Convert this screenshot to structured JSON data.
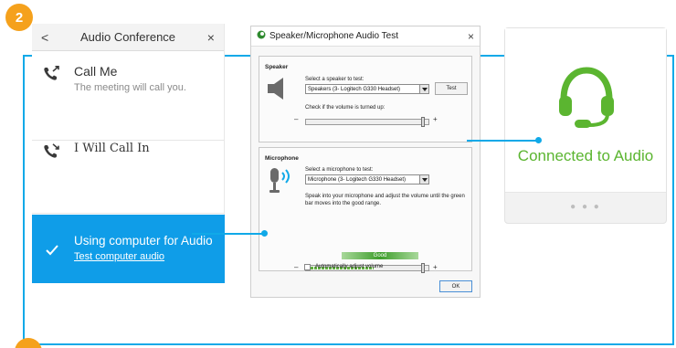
{
  "step_top": "2",
  "step_bottom": "",
  "audio_conference": {
    "title": "Audio Conference",
    "back_symbol": "<",
    "close_symbol": "×",
    "options": [
      {
        "title": "Call Me",
        "subtitle": "The meeting will call you.",
        "icon": "phone-outgoing-icon"
      },
      {
        "title": "I Will Call In",
        "icon": "phone-incoming-icon"
      },
      {
        "title": "Using computer for Audio",
        "link": "Test computer audio",
        "icon": "checkmark-icon",
        "selected": true
      }
    ]
  },
  "dialog": {
    "title": "Speaker/Microphone Audio Test",
    "close_symbol": "×",
    "speaker": {
      "group_label": "Speaker",
      "select_label": "Select a speaker to test:",
      "selected": "Speakers (3- Logitech G330 Headset)",
      "test_button": "Test",
      "volume_label": "Check if the volume is turned up:",
      "volume_level": 0.97
    },
    "microphone": {
      "group_label": "Microphone",
      "select_label": "Select a microphone to test:",
      "selected": "Microphone (3- Logitech G330 Headset)",
      "instructions": "Speak into your microphone and adjust the volume until the green bar moves into the good range.",
      "good_label": "Good",
      "input_level": 0.55,
      "volume_level": 0.97,
      "auto_adjust_label": "Automatically adjust volume",
      "auto_adjust_checked": false
    },
    "ok_button": "OK"
  },
  "status": {
    "text": "Connected to Audio",
    "icon": "headset-icon",
    "more_dots": "● ● ●"
  },
  "colors": {
    "accent": "#10a9e8",
    "selected_bg": "#0f9de8",
    "badge": "#f5a11c",
    "connected_green": "#5bb530"
  }
}
